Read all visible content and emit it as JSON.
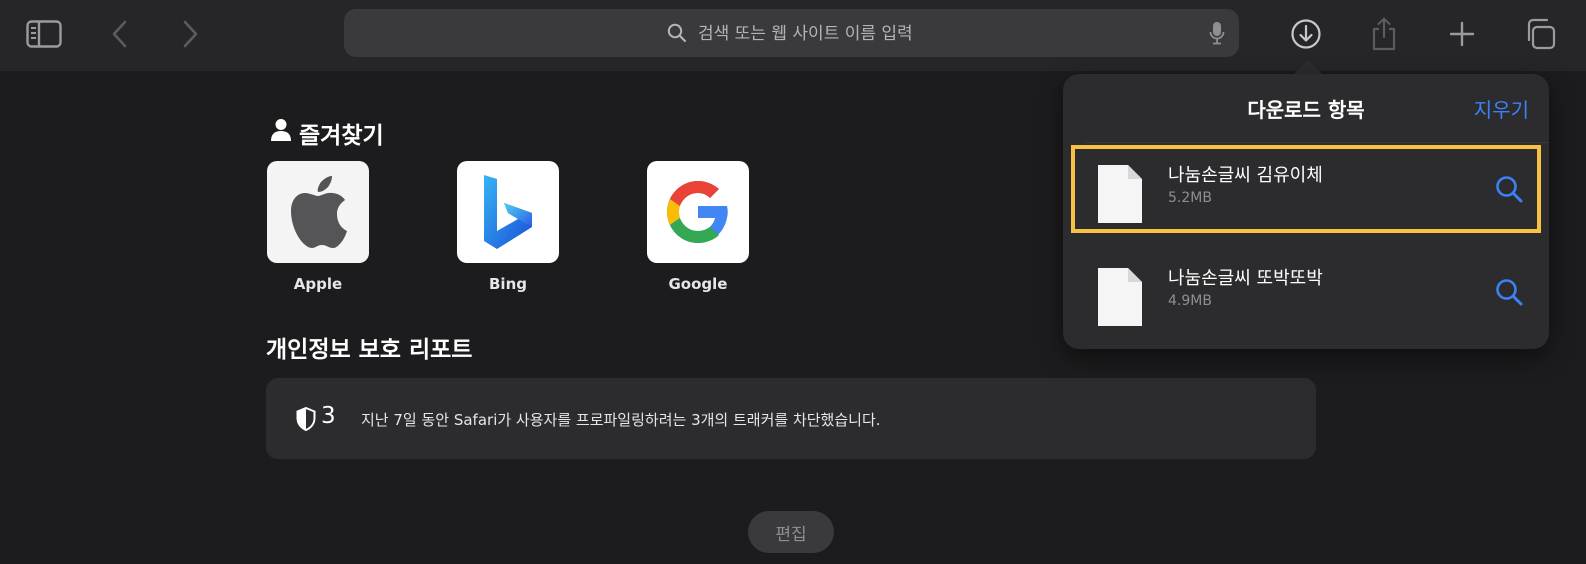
{
  "toolbar": {
    "search_placeholder": "검색 또는 웹 사이트 이름 입력"
  },
  "favorites": {
    "title": "즐겨찾기",
    "items": [
      {
        "label": "Apple"
      },
      {
        "label": "Bing"
      },
      {
        "label": "Google"
      }
    ]
  },
  "privacy": {
    "title": "개인정보 보호 리포트",
    "count": "3",
    "message": "지난 7일 동안 Safari가 사용자를 프로파일링하려는 3개의 트래커를 차단했습니다."
  },
  "edit_label": "편집",
  "downloads": {
    "title": "다운로드 항목",
    "clear_label": "지우기",
    "items": [
      {
        "name": "나눔손글씨 김유이체",
        "size": "5.2MB"
      },
      {
        "name": "나눔손글씨 또박또박",
        "size": "4.9MB"
      }
    ]
  },
  "colors": {
    "accent": "#3b82f6",
    "highlight": "#f7c244"
  }
}
